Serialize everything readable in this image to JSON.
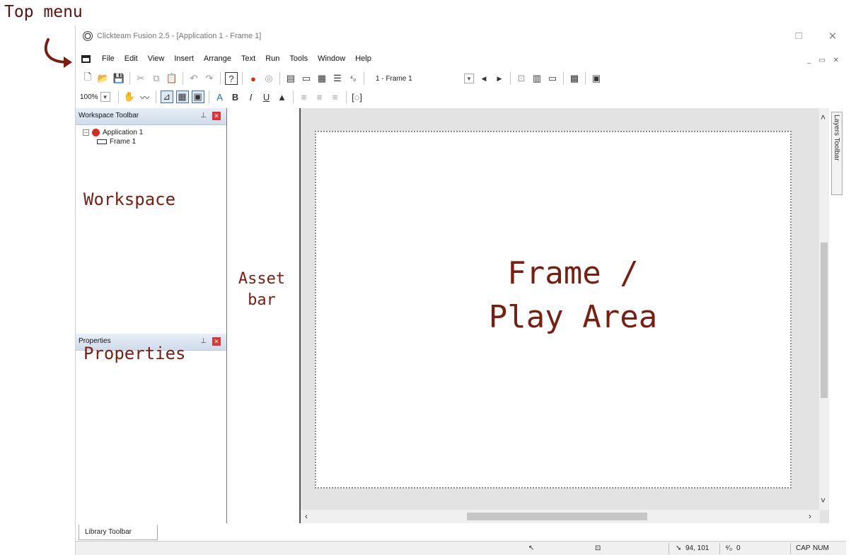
{
  "annotations": {
    "top_menu": "Top menu",
    "workspace": "Workspace",
    "properties": "Properties",
    "asset_line1": "Asset",
    "asset_line2": "bar",
    "frame_line1": "Frame /",
    "frame_line2": "Play Area"
  },
  "window": {
    "title": "Clickteam Fusion 2.5 - [Application 1 - Frame 1]"
  },
  "menu": {
    "items": [
      "File",
      "Edit",
      "View",
      "Insert",
      "Arrange",
      "Text",
      "Run",
      "Tools",
      "Window",
      "Help"
    ]
  },
  "toolbar": {
    "frame_select": "1 - Frame 1",
    "zoom": "100%"
  },
  "workspace_panel": {
    "title": "Workspace Toolbar",
    "tree": {
      "app": "Application 1",
      "frame": "Frame 1"
    }
  },
  "properties_panel": {
    "title": "Properties"
  },
  "layers_toolbar": "Layers Toolbar",
  "library_tab": "Library Toolbar",
  "status": {
    "coords": "94, 101",
    "count": "0",
    "caps": "CAP",
    "num": "NUM"
  },
  "colors": {
    "annotation": "#7a1e12",
    "panel_header": "#cfdceb",
    "accent_red": "#d42a1a"
  }
}
